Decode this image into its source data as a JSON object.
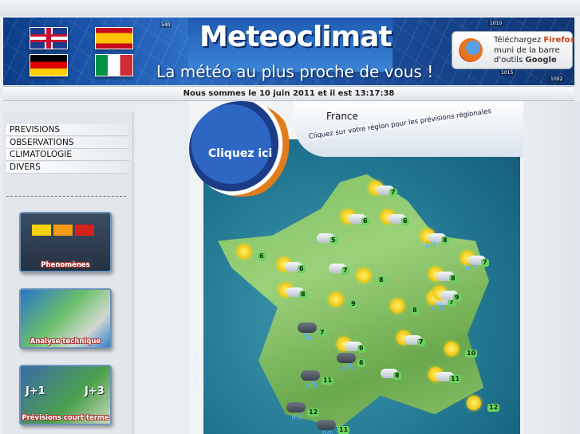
{
  "banner": {
    "logo": "Meteoclimat",
    "tagline": "La météo au plus proche de vous !",
    "flags": [
      "uk-flag",
      "spain-flag",
      "germany-flag",
      "italy-flag"
    ],
    "firefox": {
      "line1_prefix": "Téléchargez ",
      "line1_brand": "Firefox",
      "line2": "muni de la barre",
      "line3_prefix": "d'outils ",
      "line3_brand": "Google"
    },
    "isobar_labels": [
      "540",
      "1010",
      "1015",
      "1002"
    ]
  },
  "date_line": "Nous sommes le 10 juin 2011 et il est 13:17:38",
  "menu": {
    "items": [
      "PREVISIONS",
      "OBSERVATIONS",
      "CLIMATOLOGIE",
      "DIVERS"
    ]
  },
  "tiles": {
    "phenomenes": "Phenomènes",
    "analyse": "Analyse technique",
    "previsions": "Prévisions court terme",
    "j1": "J+1",
    "j3": "J+3"
  },
  "map": {
    "title": "France",
    "subtitle": "Cliquez sur votre région pour les prévisions régionales",
    "cliquez": "Cliquez ici",
    "url_fragment": "eo.com",
    "colors": {
      "sea": "#1d6f8b",
      "land": "#8bc26a",
      "accent": "#e07c1c"
    },
    "temperatures": [
      "7",
      "6",
      "6",
      "5",
      "8",
      "6",
      "6",
      "7",
      "8",
      "8",
      "7",
      "8",
      "9",
      "8",
      "7",
      "9",
      "7",
      "9",
      "7",
      "10",
      "6",
      "11",
      "8",
      "12",
      "11",
      "12",
      "11"
    ]
  }
}
